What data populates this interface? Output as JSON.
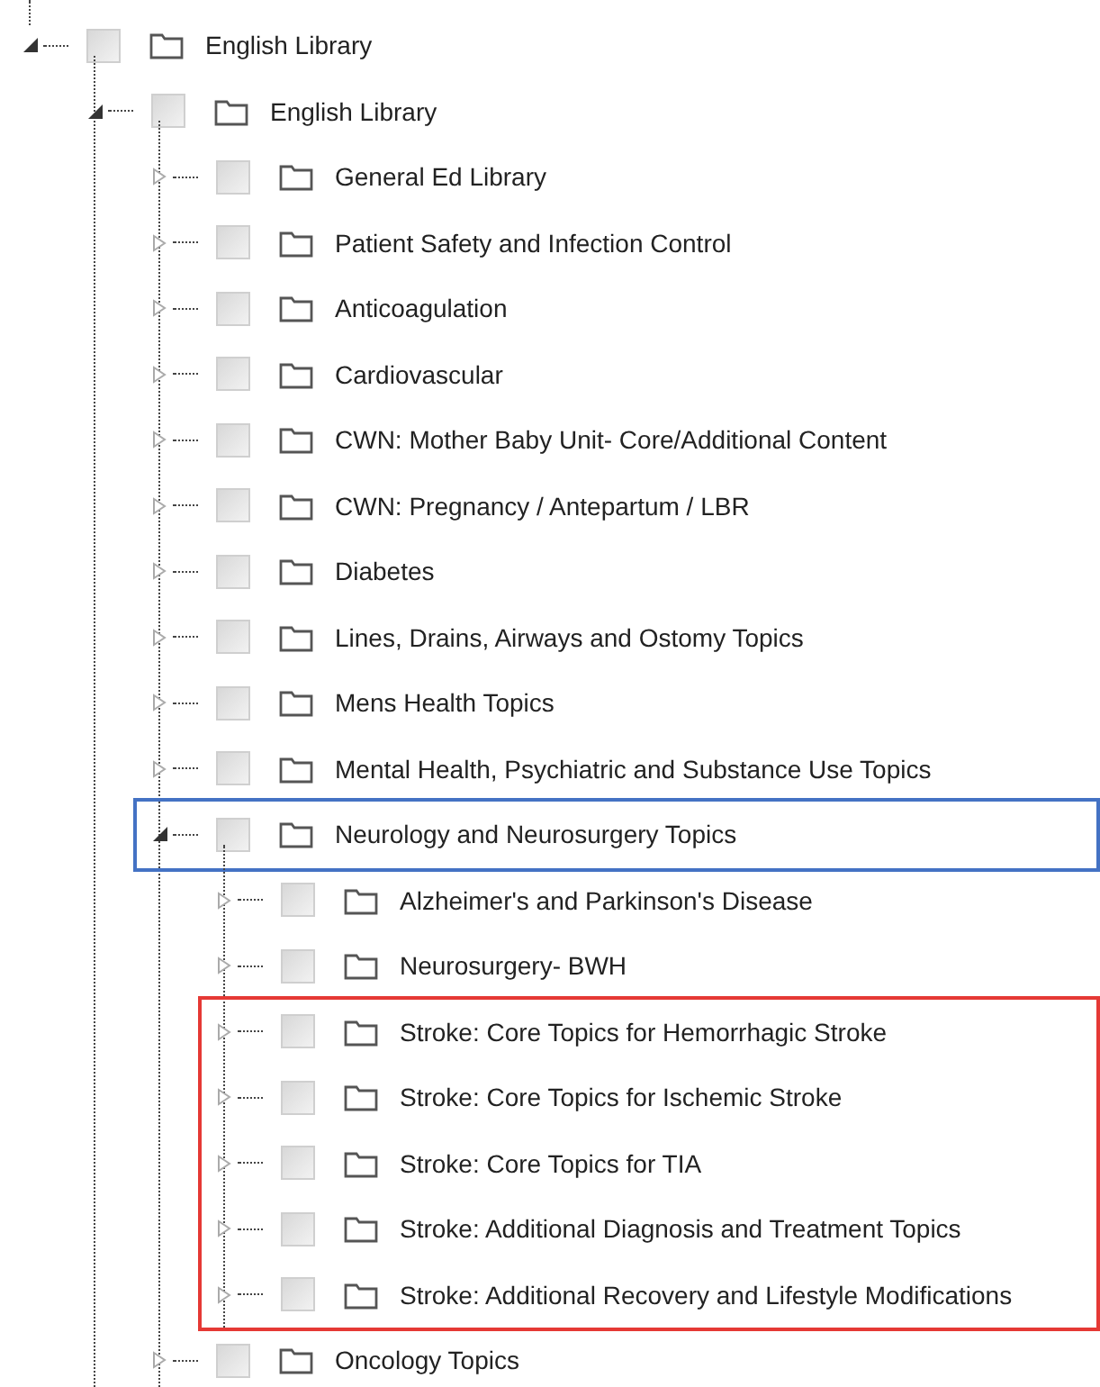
{
  "tree": [
    {
      "label": "English Library",
      "expanded": true,
      "checked": false,
      "children": [
        {
          "label": "English Library",
          "expanded": true,
          "checked": false,
          "children": [
            {
              "label": "General Ed Library",
              "expanded": false,
              "checked": false
            },
            {
              "label": "Patient Safety and Infection Control",
              "expanded": false,
              "checked": false
            },
            {
              "label": "Anticoagulation",
              "expanded": false,
              "checked": false
            },
            {
              "label": "Cardiovascular",
              "expanded": false,
              "checked": false
            },
            {
              "label": "CWN: Mother Baby Unit- Core/Additional Content",
              "expanded": false,
              "checked": false
            },
            {
              "label": "CWN: Pregnancy / Antepartum / LBR",
              "expanded": false,
              "checked": false
            },
            {
              "label": "Diabetes",
              "expanded": false,
              "checked": false
            },
            {
              "label": "Lines, Drains, Airways and Ostomy Topics",
              "expanded": false,
              "checked": false
            },
            {
              "label": "Mens Health Topics",
              "expanded": false,
              "checked": false
            },
            {
              "label": "Mental Health, Psychiatric and Substance Use Topics",
              "expanded": false,
              "checked": false
            },
            {
              "label": "Neurology and Neurosurgery Topics",
              "expanded": true,
              "checked": false,
              "color": "#4472c4",
              "children": [
                {
                  "label": "Alzheimer's and Parkinson's Disease",
                  "expanded": false,
                  "checked": false
                },
                {
                  "label": "Neurosurgery- BWH",
                  "expanded": false,
                  "checked": false
                },
                {
                  "label": "Stroke: Core Topics for Hemorrhagic Stroke",
                  "expanded": false,
                  "checked": false,
                  "color": "#e53935"
                },
                {
                  "label": "Stroke: Core Topics for Ischemic Stroke",
                  "expanded": false,
                  "checked": false,
                  "color": "#e53935"
                },
                {
                  "label": "Stroke: Core Topics for TIA",
                  "expanded": false,
                  "checked": false,
                  "color": "#e53935"
                },
                {
                  "label": "Stroke: Additional Diagnosis and Treatment Topics",
                  "expanded": false,
                  "checked": false,
                  "color": "#e53935"
                },
                {
                  "label": "Stroke: Additional Recovery and Lifestyle Modifications",
                  "expanded": false,
                  "checked": false,
                  "color": "#e53935"
                }
              ]
            },
            {
              "label": "Oncology Topics",
              "expanded": false,
              "checked": false
            }
          ]
        }
      ]
    }
  ]
}
